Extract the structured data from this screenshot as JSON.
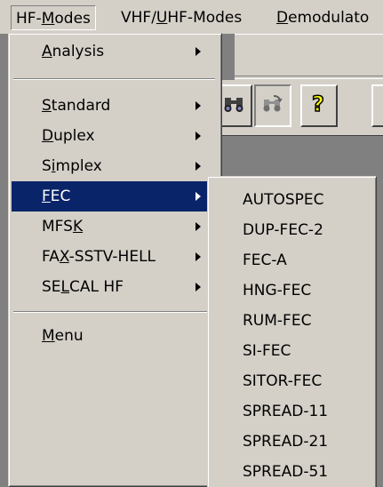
{
  "menubar": {
    "items": [
      {
        "pre": "HF-",
        "u": "M",
        "post": "odes"
      },
      {
        "pre": "VHF/",
        "u": "U",
        "post": "HF-Modes"
      },
      {
        "pre": "",
        "u": "D",
        "post": "emodulato"
      }
    ]
  },
  "menu": {
    "items": [
      {
        "pre": "",
        "u": "A",
        "post": "nalysis"
      },
      {
        "pre": "",
        "u": "S",
        "post": "tandard"
      },
      {
        "pre": "",
        "u": "D",
        "post": "uplex"
      },
      {
        "pre": "S",
        "u": "i",
        "post": "mplex"
      },
      {
        "pre": "",
        "u": "F",
        "post": "EC"
      },
      {
        "pre": "MFS",
        "u": "K",
        "post": ""
      },
      {
        "pre": "FA",
        "u": "X",
        "post": "-SSTV-HELL"
      },
      {
        "pre": "SE",
        "u": "L",
        "post": "CAL HF"
      },
      {
        "pre": "",
        "u": "M",
        "post": "enu"
      }
    ],
    "selected_index": 4
  },
  "submenu": {
    "items": [
      "AUTOSPEC",
      "DUP-FEC-2",
      "FEC-A",
      "HNG-FEC",
      "RUM-FEC",
      "SI-FEC",
      "SITOR-FEC",
      "SPREAD-11",
      "SPREAD-21",
      "SPREAD-51"
    ]
  },
  "toolbar": {
    "icons": [
      "binoculars-icon",
      "find-replace-icon",
      "help-question-icon"
    ]
  },
  "colors": {
    "highlight": "#0a246a",
    "face": "#d4d0c8",
    "workspace": "#808080"
  }
}
